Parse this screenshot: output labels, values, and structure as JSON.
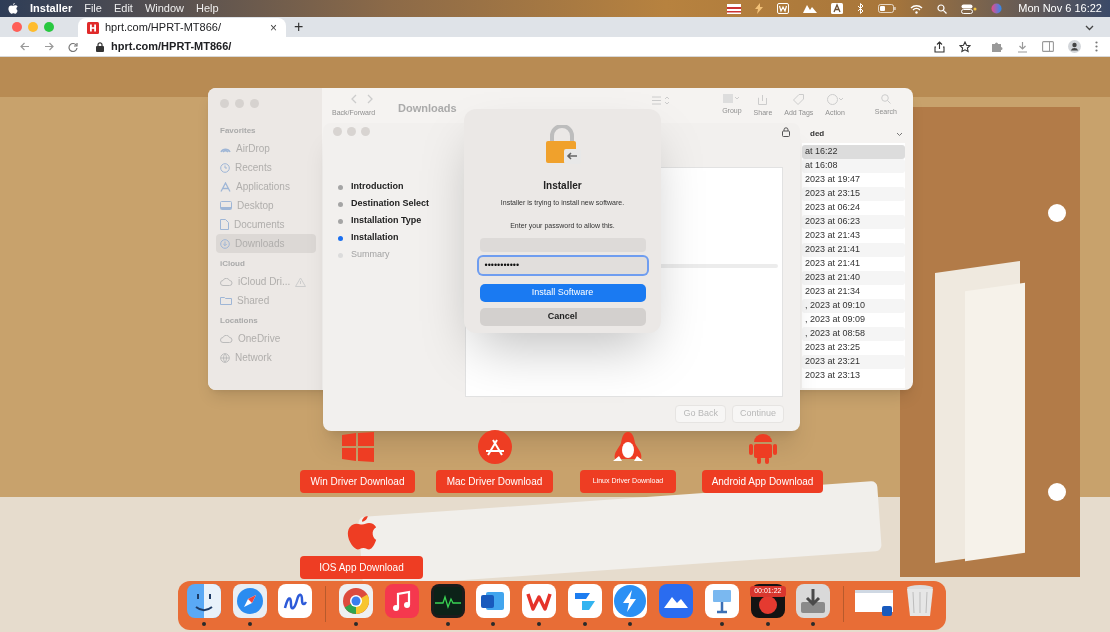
{
  "menu_bar": {
    "app": "Installer",
    "menus": [
      "File",
      "Edit",
      "Window",
      "Help"
    ],
    "clock": "Mon Nov 6 16:22"
  },
  "browser": {
    "tab": {
      "title": "hprt.com/HPRT-MT866/",
      "close": "×",
      "selected": true
    },
    "new_tab": "+",
    "url": "hprt.com/HPRT-MT866/"
  },
  "finder": {
    "title": "Downloads",
    "nav_label": "Back/Forward",
    "toolbar": [
      {
        "kind": "group",
        "label": "Group"
      },
      {
        "kind": "share",
        "label": "Share"
      },
      {
        "kind": "tags",
        "label": "Add Tags"
      },
      {
        "kind": "action",
        "label": "Action"
      },
      {
        "kind": "search",
        "label": "Search"
      }
    ],
    "sidebar": [
      {
        "heading": "Favorites",
        "items": [
          {
            "label": "AirDrop",
            "kind": "airdrop",
            "selected": false
          },
          {
            "label": "Recents",
            "kind": "recents",
            "selected": false
          },
          {
            "label": "Applications",
            "kind": "apps",
            "selected": false
          },
          {
            "label": "Desktop",
            "kind": "desktop",
            "selected": false
          },
          {
            "label": "Documents",
            "kind": "documents",
            "selected": false
          },
          {
            "label": "Downloads",
            "kind": "downloads",
            "selected": true
          }
        ]
      },
      {
        "heading": "iCloud",
        "items": [
          {
            "label": "iCloud Dri...",
            "kind": "cloud",
            "selected": false,
            "warning": true
          },
          {
            "label": "Shared",
            "kind": "shared",
            "selected": false
          }
        ]
      },
      {
        "heading": "Locations",
        "items": [
          {
            "label": "OneDrive",
            "kind": "cloud",
            "selected": false
          },
          {
            "label": "Network",
            "kind": "network",
            "selected": false
          }
        ]
      }
    ],
    "column_header": "ded",
    "dates": [
      {
        "text": "at 16:22",
        "selected": true
      },
      {
        "text": "at 16:08",
        "selected": false
      },
      {
        "text": "2023 at 19:47",
        "selected": false
      },
      {
        "text": "2023 at 23:15",
        "selected": false
      },
      {
        "text": "2023 at 06:24",
        "selected": false
      },
      {
        "text": "2023 at 06:23",
        "selected": false
      },
      {
        "text": "2023 at 21:43",
        "selected": false
      },
      {
        "text": "2023 at 21:41",
        "selected": false
      },
      {
        "text": "2023 at 21:41",
        "selected": false
      },
      {
        "text": "2023 at 21:40",
        "selected": false
      },
      {
        "text": "2023 at 21:34",
        "selected": false
      },
      {
        "text": ", 2023 at 09:10",
        "selected": false
      },
      {
        "text": ", 2023 at 09:09",
        "selected": false
      },
      {
        "text": ", 2023 at 08:58",
        "selected": false
      },
      {
        "text": "2023 at 23:25",
        "selected": false
      },
      {
        "text": "2023 at 23:21",
        "selected": false
      },
      {
        "text": "2023 at 23:13",
        "selected": false
      }
    ]
  },
  "installer": {
    "steps": [
      {
        "label": "Introduction",
        "selected": false,
        "disabled": false
      },
      {
        "label": "Destination Select",
        "selected": false,
        "disabled": false
      },
      {
        "label": "Installation Type",
        "selected": false,
        "disabled": false
      },
      {
        "label": "Installation",
        "selected": true,
        "disabled": false
      },
      {
        "label": "Summary",
        "selected": false,
        "disabled": true
      }
    ],
    "buttons": [
      "Go Back",
      "Continue"
    ]
  },
  "auth_dialog": {
    "title": "Installer",
    "message": "Installer is trying to install new software.",
    "prompt": "Enter your password to allow this.",
    "password": "•••••••••••",
    "password_focused": true,
    "buttons": [
      {
        "label": "Install Software",
        "kind": "primary"
      },
      {
        "label": "Cancel",
        "kind": "secondary"
      }
    ]
  },
  "downloads": [
    {
      "label": "Win Driver Download",
      "kind": "windows"
    },
    {
      "label": "Mac Driver Download",
      "kind": "appstore"
    },
    {
      "label": "Linux Driver Download",
      "kind": "linux"
    },
    {
      "label": "Android App Download",
      "kind": "android"
    },
    {
      "label": "IOS App Download",
      "kind": "apple"
    }
  ],
  "dock": {
    "sections": [
      {
        "items": [
          {
            "kind": "finder",
            "running": true
          },
          {
            "kind": "safari",
            "running": true
          },
          {
            "kind": "freeform",
            "running": false
          }
        ]
      },
      {
        "items": [
          {
            "kind": "chrome",
            "running": true
          },
          {
            "kind": "music",
            "running": false
          },
          {
            "kind": "activity",
            "running": true
          },
          {
            "kind": "word",
            "running": true
          },
          {
            "kind": "wps",
            "running": true
          },
          {
            "kind": "lark",
            "running": true
          },
          {
            "kind": "bolt",
            "running": true
          },
          {
            "kind": "mountain",
            "running": false
          },
          {
            "kind": "keynote",
            "running": true
          },
          {
            "kind": "recorder",
            "running": true,
            "badge": "00:01:22"
          },
          {
            "kind": "installer",
            "running": true
          }
        ]
      },
      {
        "items": [
          {
            "kind": "window",
            "running": false
          },
          {
            "kind": "trash",
            "running": false
          }
        ]
      }
    ]
  }
}
